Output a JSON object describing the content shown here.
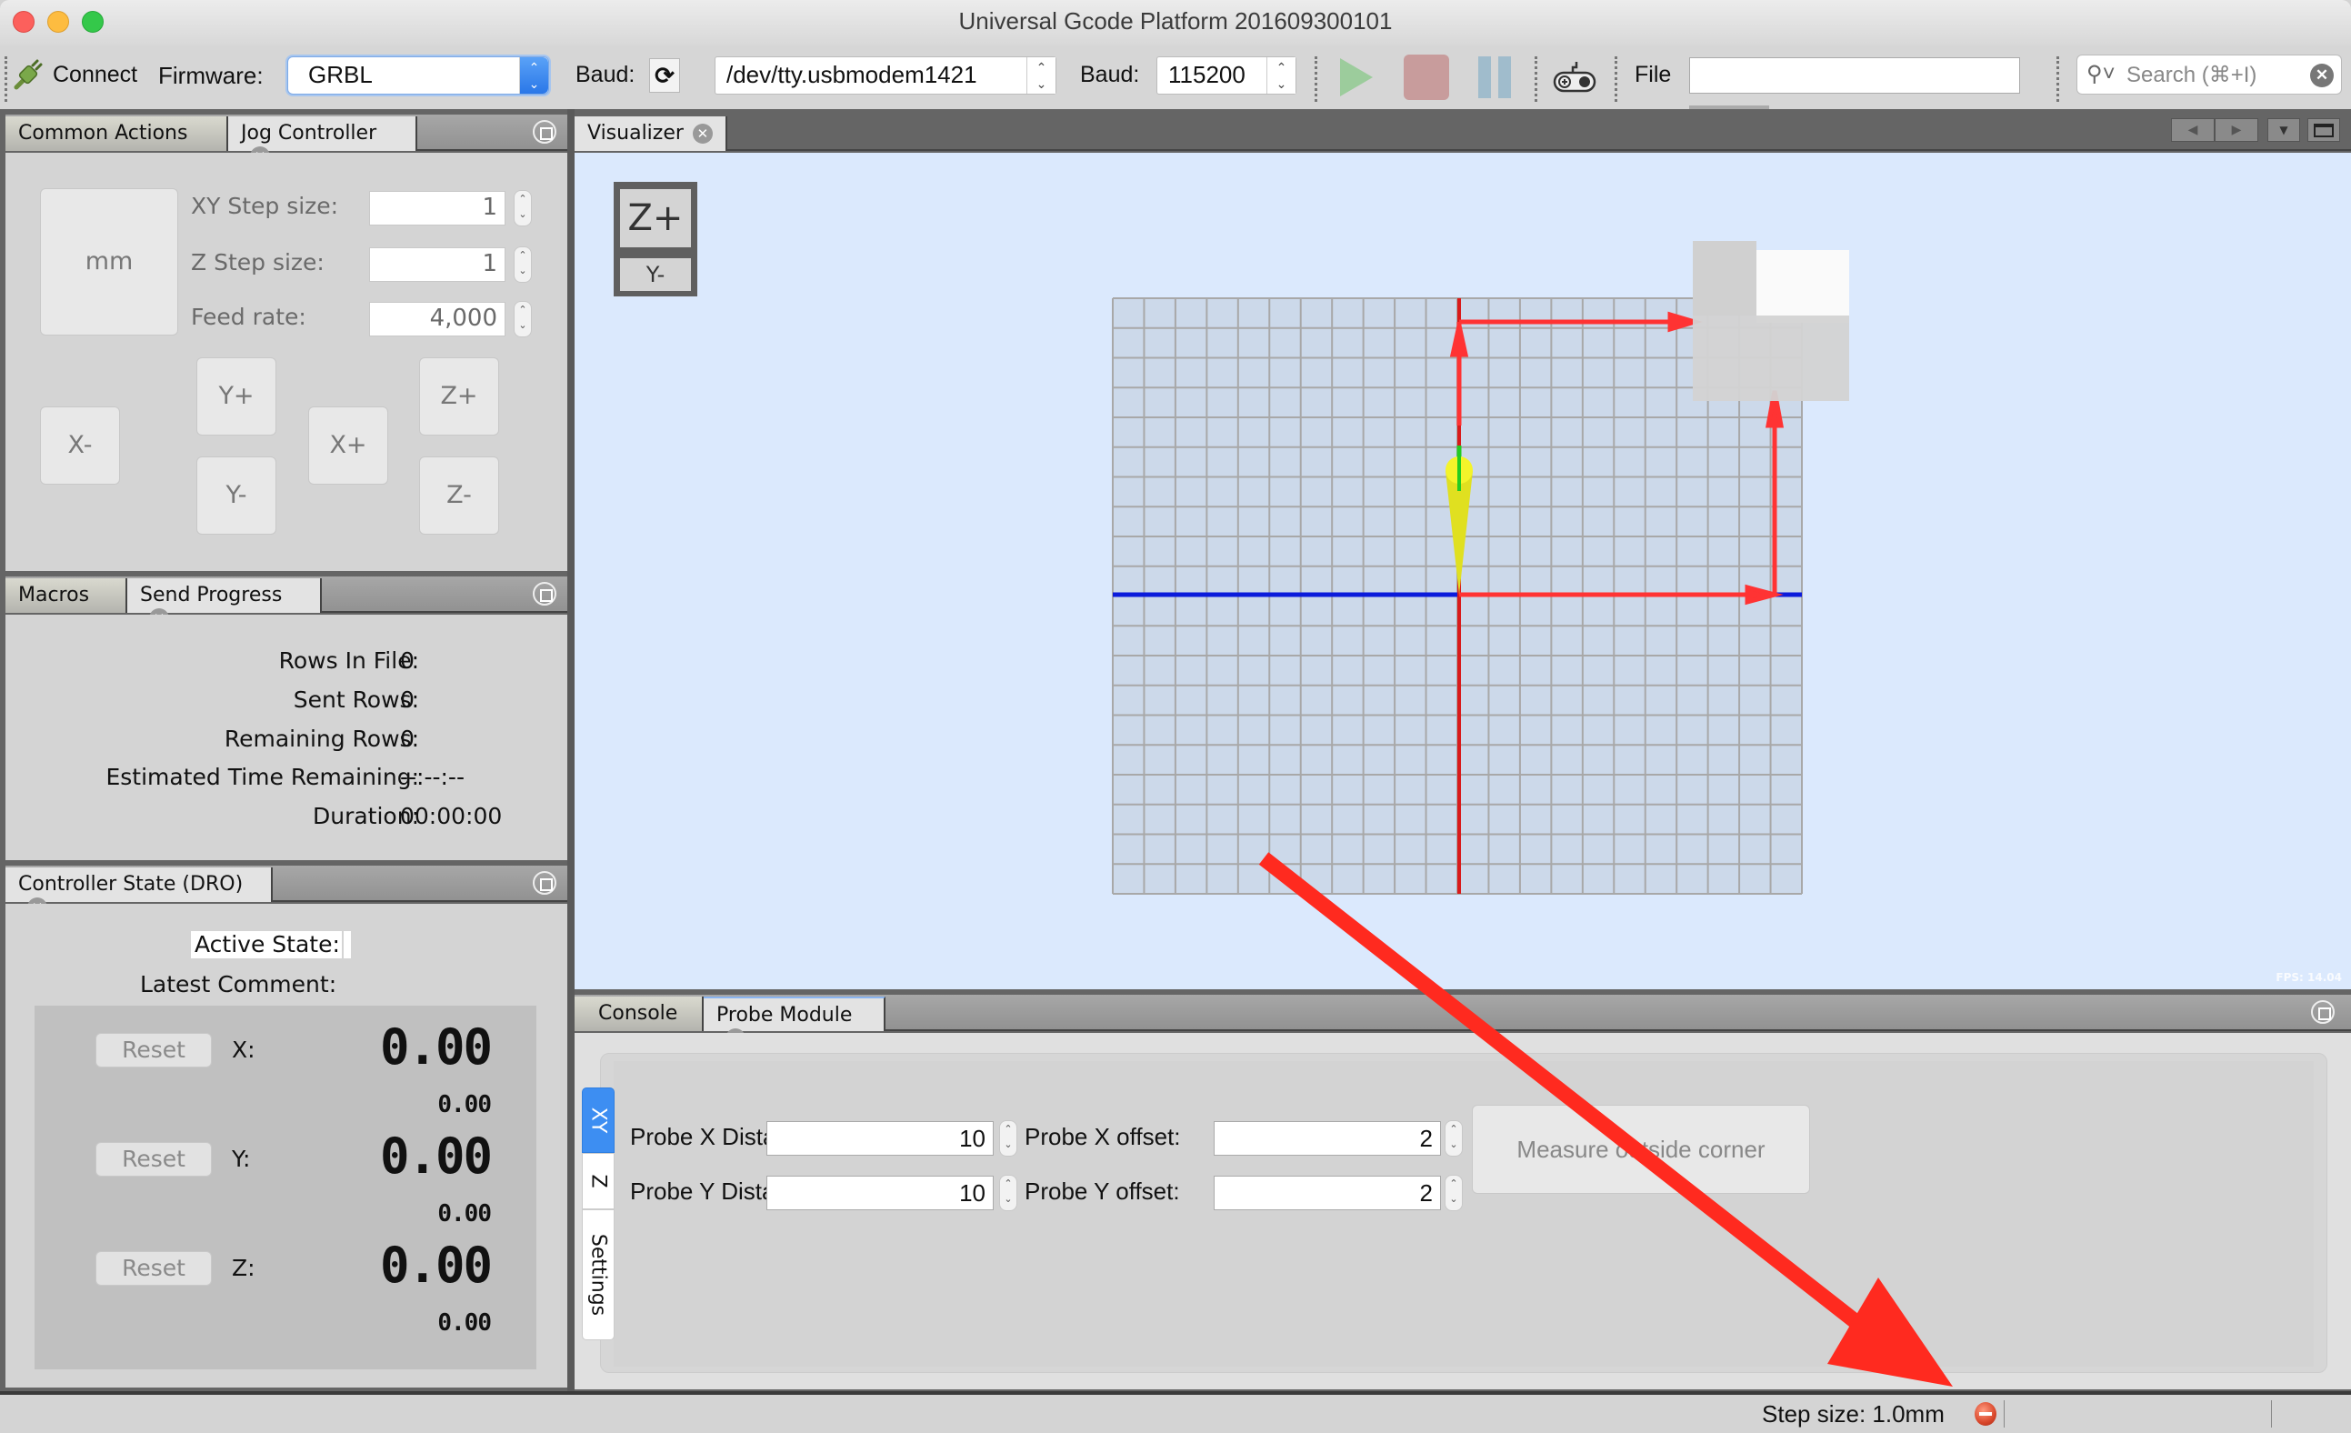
{
  "window": {
    "title": "Universal Gcode Platform 201609300101",
    "traffic_colors": {
      "close": "#fc605c",
      "minimize": "#fdbc40",
      "zoom": "#34c84a"
    }
  },
  "toolbar": {
    "connect_label": "Connect",
    "firmware_label": "Firmware:",
    "firmware_value": "GRBL",
    "port_label": "Baud:",
    "port_value": "/dev/tty.usbmodem1421",
    "baud_label": "Baud:",
    "baud_value": "115200",
    "file_label": "File",
    "file_value": "",
    "search_placeholder": "Search (⌘+I)",
    "icons": {
      "connect": "plug-icon",
      "refresh": "refresh-icon",
      "play": "play-icon",
      "stop": "stop-icon",
      "pause": "pause-icon",
      "gamepad": "gamepad-icon",
      "search": "search-icon",
      "clear": "clear-icon"
    },
    "colors": {
      "play": "#9ccc9c",
      "stop": "#c89c9c",
      "pause": "#a0bccc"
    }
  },
  "jog_panel": {
    "tabs": [
      {
        "label": "Common Actions",
        "active": false
      },
      {
        "label": "Jog Controller",
        "active": true
      }
    ],
    "unit_button": "mm",
    "xy_step_label": "XY Step size:",
    "xy_step_value": "1",
    "z_step_label": "Z Step size:",
    "z_step_value": "1",
    "feed_rate_label": "Feed rate:",
    "feed_rate_value": "4,000",
    "buttons": {
      "x_minus": "X-",
      "x_plus": "X+",
      "y_plus": "Y+",
      "y_minus": "Y-",
      "z_plus": "Z+",
      "z_minus": "Z-"
    }
  },
  "send_progress_panel": {
    "tabs": [
      {
        "label": "Macros",
        "active": false
      },
      {
        "label": "Send Progress",
        "active": true
      }
    ],
    "rows": [
      {
        "label": "Rows In File:",
        "value": "0"
      },
      {
        "label": "Sent Rows:",
        "value": "0"
      },
      {
        "label": "Remaining Rows:",
        "value": "0"
      },
      {
        "label": "Estimated Time Remaining:",
        "value": "--:--:--"
      },
      {
        "label": "Duration:",
        "value": "00:00:00"
      }
    ]
  },
  "dro_panel": {
    "tab_label": "Controller State (DRO)",
    "active_state_label": "Active State:",
    "active_state_value": "",
    "latest_comment_label": "Latest Comment:",
    "latest_comment_value": "",
    "reset_label": "Reset",
    "axes": [
      {
        "label": "X:",
        "work": "0.00",
        "machine": "0.00"
      },
      {
        "label": "Y:",
        "work": "0.00",
        "machine": "0.00"
      },
      {
        "label": "Z:",
        "work": "0.00",
        "machine": "0.00"
      }
    ]
  },
  "visualizer": {
    "tab_label": "Visualizer",
    "view_cube": {
      "top": "Z+",
      "front": "Y-"
    },
    "fps_text": "FPS: 14.04",
    "colors": {
      "background": "#dbe9fd",
      "grid_fill": "#ccd9ea",
      "grid_line": "#a8a8a8",
      "x_axis": "#0b1bdb",
      "y_axis": "#d91a1a",
      "z_axis": "#22cc22",
      "tool": "#f0f020",
      "path": "#ff3333"
    }
  },
  "bottom_panel": {
    "tabs": [
      {
        "label": "Console",
        "active": false
      },
      {
        "label": "Probe Module",
        "active": true
      }
    ],
    "side_tabs": [
      {
        "label": "XY",
        "active": true
      },
      {
        "label": "Z",
        "active": false
      },
      {
        "label": "Settings",
        "active": false
      }
    ],
    "probe_x_distance_label": "Probe X Distance:",
    "probe_x_distance_value": "10",
    "probe_y_distance_label": "Probe Y Distance:",
    "probe_y_distance_value": "10",
    "probe_x_offset_label": "Probe X offset:",
    "probe_x_offset_value": "2",
    "probe_y_offset_label": "Probe Y offset:",
    "probe_y_offset_value": "2",
    "measure_button": "Measure outside corner"
  },
  "status_bar": {
    "step_size_text": "Step size: 1.0mm",
    "connection_icon": "disconnected-icon",
    "connection_color": "#d9472b"
  },
  "annotation": {
    "arrow_color": "#ff2a1f"
  }
}
